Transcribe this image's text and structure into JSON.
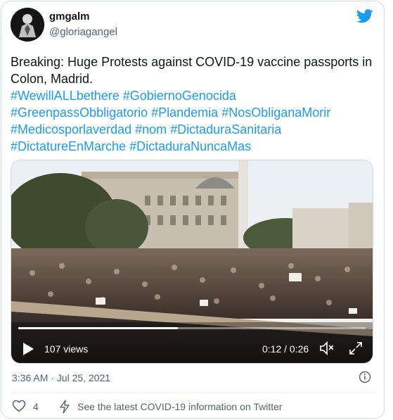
{
  "author": {
    "name": "gmgalm",
    "handle": "@gloriagangel"
  },
  "tweet": {
    "text": "Breaking: Huge Protests against COVID-19 vaccine passports in Colon, Madrid.",
    "hashtags": [
      "#WewillALLbethere",
      "#GobiernoGenocida",
      "#GreenpassObbligatorio",
      "#Plandemia",
      "#NosObliganaMorir",
      "#Medicosporlaverdad",
      "#nom",
      "#DictaduraSanitaria",
      "#DictatureEnMarche",
      "#DictaduraNuncaMas"
    ],
    "timestamp": "3:36 AM · Jul 25, 2021"
  },
  "video": {
    "views": "107 views",
    "time": "0:12 / 0:26",
    "progress": 0.46
  },
  "actions": {
    "likes": "4",
    "covid_link": "See the latest COVID-19 information on Twitter"
  },
  "colors": {
    "link": "#1d9bf0",
    "muted": "#536471",
    "twitter_blue": "#1d9bf0"
  },
  "icons": [
    "twitter-bird-icon",
    "play-icon",
    "volume-icon",
    "fullscreen-icon",
    "info-icon",
    "heart-icon",
    "bolt-icon"
  ]
}
